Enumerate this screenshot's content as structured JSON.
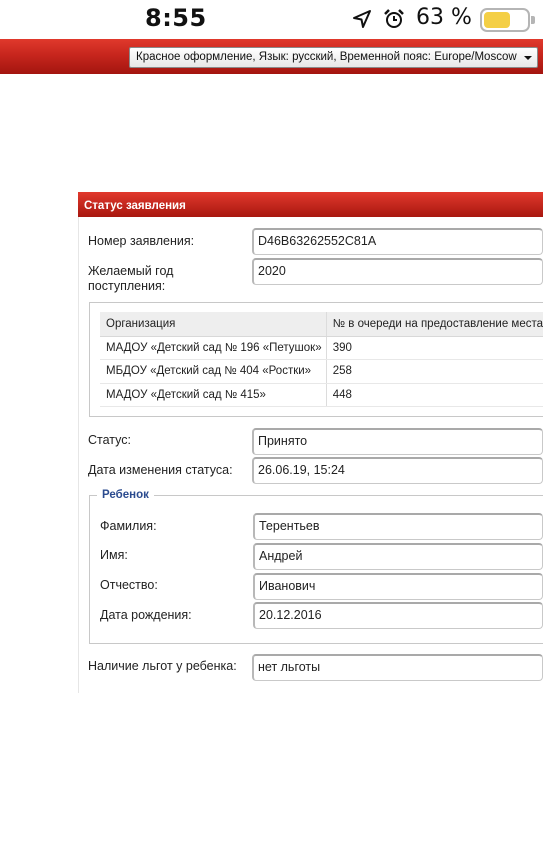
{
  "status_bar": {
    "time": "8:55",
    "battery_percent_label": "63 %",
    "battery_level": 0.63,
    "icons": [
      "location-arrow-icon",
      "alarm-clock-icon",
      "battery-icon"
    ]
  },
  "header": {
    "theme_select_value": "Красное оформление, Язык: русский, Временной пояс: Europe/Moscow"
  },
  "panel": {
    "title": "Статус заявления",
    "application_number": {
      "label": "Номер заявления:",
      "value": "D46B63262552C81A"
    },
    "desired_year": {
      "label": "Желаемый год поступления:",
      "value": "2020"
    },
    "org_table": {
      "columns": [
        "Организация",
        "№ в очереди на предоставление места"
      ],
      "rows": [
        {
          "org": "МАДОУ «Детский сад № 196 «Петушок»",
          "queue": "390"
        },
        {
          "org": "МБДОУ «Детский сад № 404 «Ростки»",
          "queue": "258"
        },
        {
          "org": "МАДОУ «Детский сад № 415»",
          "queue": "448"
        }
      ]
    },
    "status": {
      "label": "Статус:",
      "value": "Принято"
    },
    "status_changed": {
      "label": "Дата изменения статуса:",
      "value": "26.06.19, 15:24"
    },
    "child": {
      "legend": "Ребенок",
      "last_name": {
        "label": "Фамилия:",
        "value": "Терентьев"
      },
      "first_name": {
        "label": "Имя:",
        "value": "Андрей"
      },
      "patronymic": {
        "label": "Отчество:",
        "value": "Иванович"
      },
      "birth_date": {
        "label": "Дата рождения:",
        "value": "20.12.2016"
      }
    },
    "benefits": {
      "label": "Наличие льгот у ребенка:",
      "value": "нет льготы"
    }
  },
  "colors": {
    "header_red": "#c7261d",
    "legend_blue": "#2b4b8f",
    "battery_yellow": "#f4cf45"
  }
}
